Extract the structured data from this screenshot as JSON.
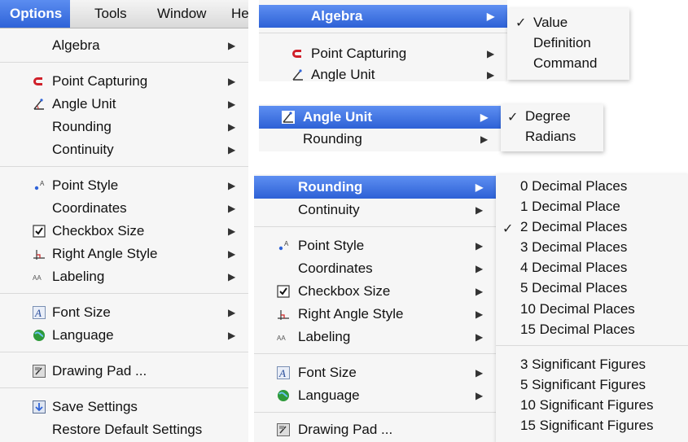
{
  "menubar": {
    "options": "Options",
    "tools": "Tools",
    "window": "Window",
    "help": "Hel"
  },
  "left_menu": {
    "algebra": "Algebra",
    "point_capturing": "Point Capturing",
    "angle_unit": "Angle Unit",
    "rounding": "Rounding",
    "continuity": "Continuity",
    "point_style": "Point Style",
    "coordinates": "Coordinates",
    "checkbox_size": "Checkbox Size",
    "right_angle_style": "Right Angle Style",
    "labeling": "Labeling",
    "font_size": "Font Size",
    "language": "Language",
    "drawing_pad": "Drawing Pad ...",
    "save_settings": "Save Settings",
    "restore_default": "Restore Default Settings"
  },
  "algebra_submenu": {
    "value": "Value",
    "definition": "Definition",
    "command": "Command",
    "checked": "✓"
  },
  "angle_submenu": {
    "degree": "Degree",
    "radians": "Radians",
    "checked": "✓"
  },
  "rounding_submenu": {
    "decimals": [
      "0 Decimal Places",
      "1 Decimal Place",
      "2 Decimal Places",
      "3 Decimal Places",
      "4 Decimal Places",
      "5 Decimal Places",
      "10 Decimal Places",
      "15 Decimal Places"
    ],
    "figures": [
      "3 Significant Figures",
      "5 Significant Figures",
      "10 Significant Figures",
      "15 Significant Figures"
    ],
    "checked": "✓"
  },
  "arrow": "▶",
  "colors": {
    "highlight": "#2f63d8",
    "point_capturing_icon": "#d0202a",
    "language_icon": "#2e9a3a"
  }
}
